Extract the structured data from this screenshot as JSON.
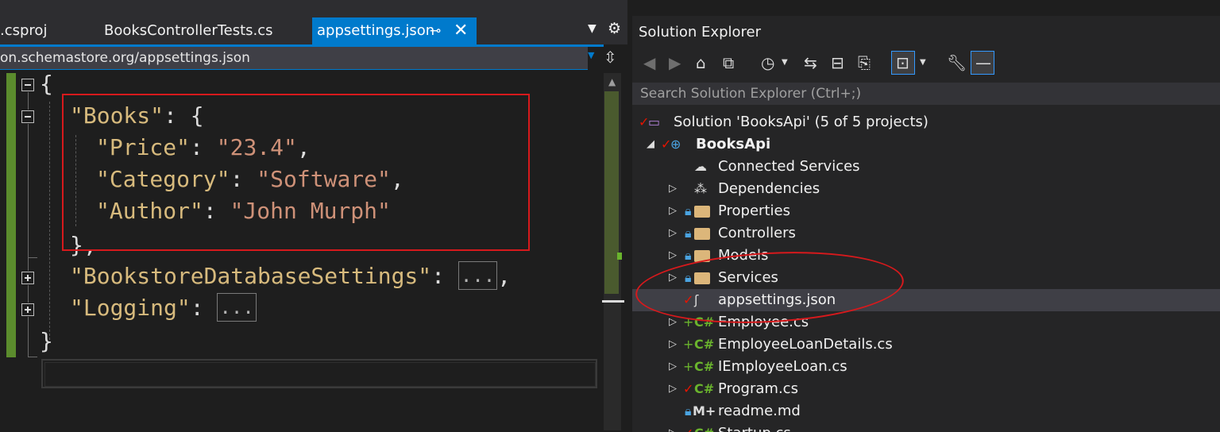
{
  "editor": {
    "tabs": [
      {
        "label": ".csproj"
      },
      {
        "label": "BooksControllerTests.cs"
      },
      {
        "label": "appsettings.json"
      }
    ],
    "schema": "on.schemastore.org/appsettings.json",
    "code": {
      "open_brace": "{",
      "books_key": "\"Books\"",
      "books_open": ": {",
      "price_key": "\"Price\"",
      "price_val": "\"23.4\"",
      "category_key": "\"Category\"",
      "category_val": "\"Software\"",
      "author_key": "\"Author\"",
      "author_val": "\"John Murph\"",
      "books_close": "},",
      "db_key": "\"BookstoreDatabaseSettings\"",
      "collapsed": "...",
      "logging_key": "\"Logging\"",
      "close_brace": "}"
    },
    "colors": {
      "key": "#d7ba7d",
      "string": "#ce9178",
      "highlight": "#d7191c",
      "accent": "#007acc"
    }
  },
  "solution_explorer": {
    "title": "Solution Explorer",
    "search_placeholder": "Search Solution Explorer (Ctrl+;)",
    "toolbar_icons": [
      "back-icon",
      "forward-icon",
      "home-icon",
      "switch-views-icon",
      "pending-changes-icon",
      "sync-icon",
      "collapse-all-icon",
      "show-all-files-icon",
      "preview-selected-icon",
      "properties-icon",
      "pin-icon"
    ],
    "tree": [
      {
        "label": "Solution 'BooksApi' (5 of 5 projects)"
      },
      {
        "label": "BooksApi"
      },
      {
        "label": "Connected Services"
      },
      {
        "label": "Dependencies"
      },
      {
        "label": "Properties"
      },
      {
        "label": "Controllers"
      },
      {
        "label": "Models"
      },
      {
        "label": "Services"
      },
      {
        "label": "appsettings.json"
      },
      {
        "label": "Employee.cs"
      },
      {
        "label": "EmployeeLoanDetails.cs"
      },
      {
        "label": "IEmployeeLoan.cs"
      },
      {
        "label": "Program.cs"
      },
      {
        "label": "readme.md"
      },
      {
        "label": "Startup.cs"
      }
    ],
    "icon_glyphs": {
      "csharp": "C#",
      "markdown": "M+"
    }
  }
}
